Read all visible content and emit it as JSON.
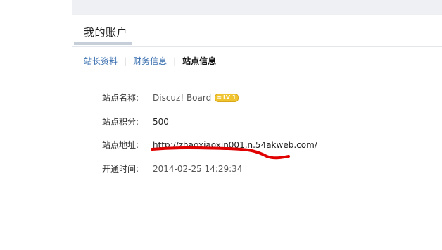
{
  "title": "我的账户",
  "tabs": [
    {
      "label": "站长资料",
      "active": false
    },
    {
      "label": "财务信息",
      "active": false
    },
    {
      "label": "站点信息",
      "active": true
    }
  ],
  "info": {
    "name_label": "站点名称:",
    "name_value": "Discuz! Board",
    "level_badge": "LV 1",
    "points_label": "站点积分:",
    "points_value": "500",
    "address_label": "站点地址:",
    "address_value": "http://zhaoxiaoxin001.n.54akweb.com/",
    "open_time_label": "开通时间:",
    "open_time_value": "2014-02-25 14:29:34"
  },
  "colors": {
    "link": "#3a6fb0",
    "annotation": "#e00000",
    "badge": "#f0c430"
  }
}
